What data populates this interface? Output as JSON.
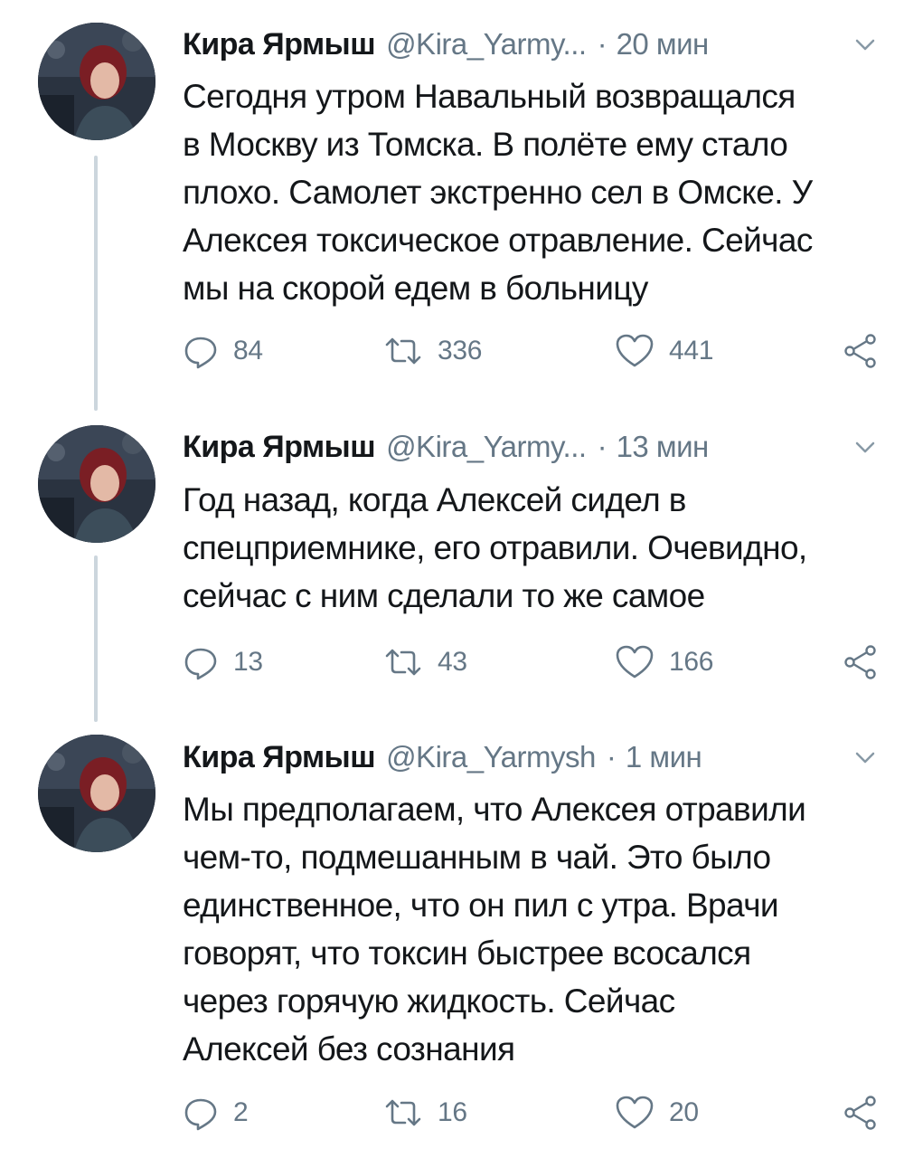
{
  "colors": {
    "text": "#14171a",
    "secondary": "#657786",
    "thread_line": "#ccd6dd",
    "icon": "#657786"
  },
  "tweets": [
    {
      "name": "Кира Ярмыш",
      "handle": "@Kira_Yarmy...",
      "separator": "·",
      "time": "20 мин",
      "text": "Сегодня утром Навальный возвращался\nв Москву из Томска. В полёте ему стало\nплохо. Самолет экстренно сел в Омске. У\nАлексея токсическое отравление. Сейчас\nмы на скорой едем в больницу",
      "replies": "84",
      "retweets": "336",
      "likes": "441",
      "icons": [
        "avatar",
        "chevron-down-icon",
        "reply-icon",
        "retweet-icon",
        "like-icon",
        "share-icon"
      ]
    },
    {
      "name": "Кира Ярмыш",
      "handle": "@Kira_Yarmy...",
      "separator": "·",
      "time": "13 мин",
      "text": "Год назад, когда Алексей сидел в\nспецприемнике, его отравили. Очевидно,\nсейчас с ним сделали то же самое",
      "replies": "13",
      "retweets": "43",
      "likes": "166",
      "icons": [
        "avatar",
        "chevron-down-icon",
        "reply-icon",
        "retweet-icon",
        "like-icon",
        "share-icon"
      ]
    },
    {
      "name": "Кира Ярмыш",
      "handle": "@Kira_Yarmysh",
      "separator": "·",
      "time": "1 мин",
      "text": "Мы предполагаем, что Алексея отравили\nчем-то, подмешанным в чай. Это было\nединственное, что он пил с утра. Врачи\nговорят, что токсин быстрее всосался\nчерез горячую жидкость. Сейчас\nАлексей без сознания",
      "replies": "2",
      "retweets": "16",
      "likes": "20",
      "icons": [
        "avatar",
        "chevron-down-icon",
        "reply-icon",
        "retweet-icon",
        "like-icon",
        "share-icon"
      ]
    }
  ]
}
